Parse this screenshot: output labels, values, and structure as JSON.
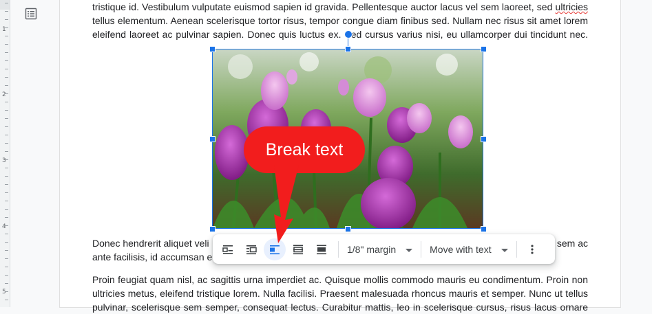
{
  "ruler": {
    "marks": [
      "1",
      "2",
      "3",
      "4",
      "5"
    ]
  },
  "icons": {
    "outline": "document-outline-icon"
  },
  "document": {
    "para1": [
      "tristique id. Vestibulum vulputate euismod sapien id gravida. Pellentesque auctor lacus vel sem laoreet, sed",
      "ultricies",
      "tellus elementum. Aenean scelerisque tortor risus, tempor congue diam finibus sed. Nullam nec risus sit amet lorem",
      "eleifend laoreet ac pulvinar sapien. Donec quis luctus ex. Sed cursus varius nisi, eu ullamcorper dui tincidunt nec."
    ],
    "para2": [
      "Donec hendrerit aliquet veli",
      "sem ac",
      "ante facilisis, id accumsan e"
    ],
    "para3": [
      "Proin feugiat quam nisl, ac sagittis urna imperdiet ac. Quisque mollis commodo mauris eu condimentum. Proin non",
      "ultricies metus, eleifend tristique lorem. Nulla facilisi. Praesent malesuada rhoncus mauris et semper. Nunc ut tellus",
      "pulvinar, scelerisque sem semper, consequat lectus. Curabitur mattis, leo in scelerisque cursus, risus lacus ornare"
    ]
  },
  "image": {
    "description_icon": "tulip-photo"
  },
  "toolbar": {
    "wrap_buttons": [
      "inline-icon",
      "wrap-text-icon",
      "break-text-icon",
      "behind-text-icon",
      "in-front-of-text-icon"
    ],
    "active_index": 2,
    "margin_label": "1/8\" margin",
    "position_label": "Move with text",
    "more_icon": "more-vert-icon"
  },
  "callout": {
    "text": "Break text",
    "color": "#f21d1d"
  },
  "colors": {
    "accent": "#1a73e8",
    "text": "#202124"
  }
}
